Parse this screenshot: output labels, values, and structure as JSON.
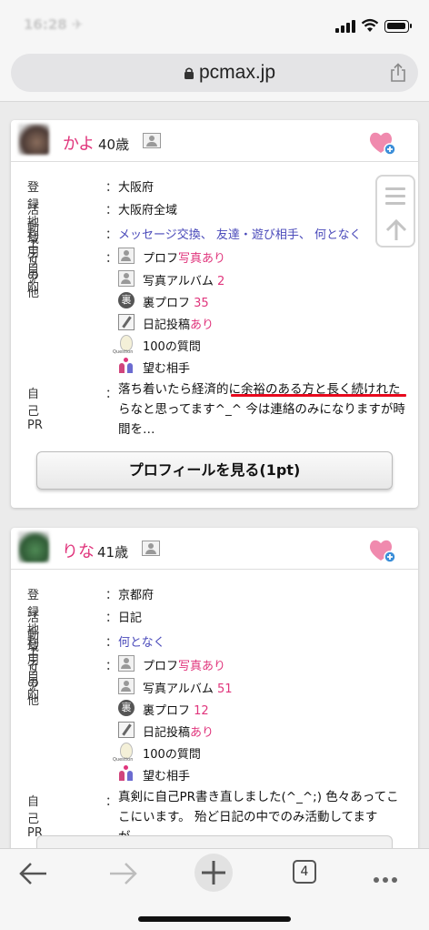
{
  "status": {
    "time": "16:28 ✈"
  },
  "browser": {
    "url": "pcmax.jp",
    "tabs_count": "4"
  },
  "labels": {
    "area": "登録地域",
    "activity": "活動エリア",
    "purpose": "利用目的",
    "other": "その他",
    "pr": "自己PR",
    "colon": "：",
    "prof": "プロフ",
    "photo_yes": "写真あり",
    "album": "写真アルバム",
    "ura": "裏プロフ",
    "ura_icon": "裏",
    "diary": "日記投稿",
    "diary_yes": "あり",
    "q100": "100の質問",
    "question_icon": "Question",
    "wish": "望む相手"
  },
  "profiles": [
    {
      "name": "かよ",
      "age": "40歳",
      "area": "大阪府",
      "activity": "大阪府全域",
      "purposes": [
        "メッセージ交換、",
        "友達・遊び相手、",
        "何となく"
      ],
      "album_count": "2",
      "ura_count": "35",
      "pr": "落ち着いたら経済的に余裕のある方と長く続けれたらなと思ってます^_^ 今は連絡のみになりますが時間を…",
      "button": "プロフィールを見る(1pt)"
    },
    {
      "name": "りな",
      "age": "41歳",
      "area": "京都府",
      "activity": "日記",
      "purposes": [
        "何となく"
      ],
      "album_count": "51",
      "ura_count": "12",
      "pr": "真剣に自己PR書き直しました(^_^;) 色々あってここにいます。 殆ど日記の中でのみ活動してますが、…"
    }
  ],
  "colors": {
    "accent_pink": "#e0357c",
    "link_blue": "#4a4aba",
    "underline_red": "#e8091e"
  }
}
